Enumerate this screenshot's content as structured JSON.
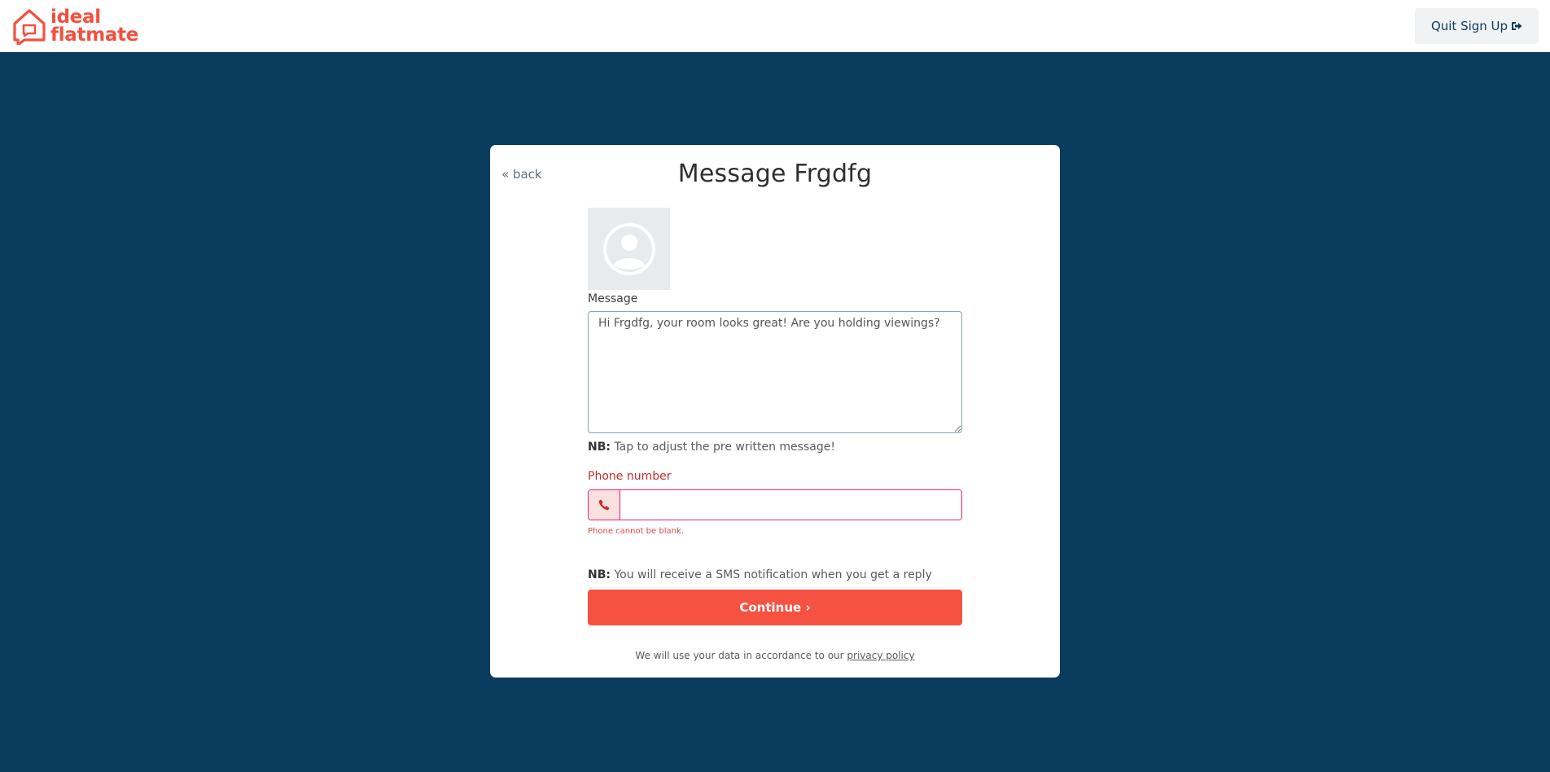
{
  "header": {
    "logo_line1": "ideal",
    "logo_line2": "flatmate",
    "quit_label": "Quit Sign Up",
    "quit_icon": "sign-out-icon",
    "brand_color": "#f2503f"
  },
  "page": {
    "background": "#093c5d"
  },
  "card": {
    "back_label": "« back",
    "title": "Message Frgdfg",
    "avatar_icon": "user-circle-icon",
    "message_label": "Message",
    "message_value": "Hi Frgdfg, your room looks great! Are you holding viewings?",
    "nb1_prefix": "NB:",
    "nb1_text": " Tap to adjust the pre written message!",
    "phone_label": "Phone number",
    "phone_icon": "phone-icon",
    "phone_value": "",
    "phone_error": "Phone cannot be blank.",
    "nb2_prefix": "NB:",
    "nb2_text": " You will receive a SMS notification when you get a reply",
    "continue_label": "Continue",
    "continue_icon": "chevron-right-icon",
    "privacy_text": "We will use your data in accordance to our ",
    "privacy_link": "privacy policy",
    "accent": "#f55242",
    "error_color": "#e8256d"
  }
}
